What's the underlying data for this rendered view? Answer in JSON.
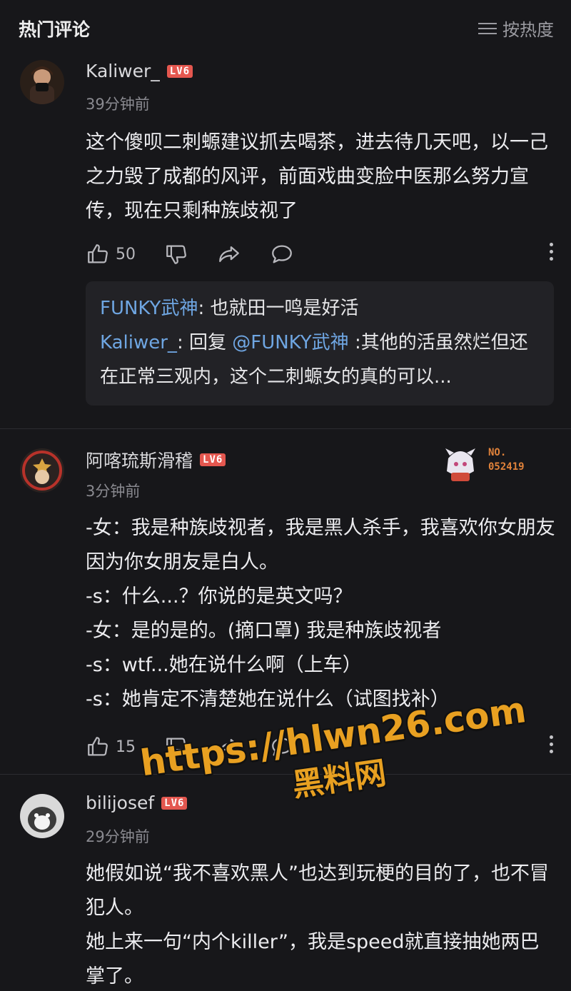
{
  "header": {
    "title": "热门评论",
    "sort_label": "按热度"
  },
  "comments": [
    {
      "username": "Kaliwer_",
      "level": "LV6",
      "time": "39分钟前",
      "text": "这个傻呗二刺螈建议抓去喝茶，进去待几天吧，以一己之力毁了成都的风评，前面戏曲变脸中医那么努力宣传，现在只剩种族歧视了",
      "likes": "50",
      "replies": [
        {
          "name": "FUNKY武神",
          "sep": ": ",
          "text": "也就田一鸣是好活"
        },
        {
          "name": "Kaliwer_",
          "sep": ": 回复 ",
          "mention": "@FUNKY武神",
          "text": " :其他的活虽然烂但还在正常三观内，这个二刺螈女的真的可以..."
        }
      ]
    },
    {
      "username": "阿喀琉斯滑稽",
      "level": "LV6",
      "time": "3分钟前",
      "fan_label": "NO.",
      "fan_number": "052419",
      "text": "-女：我是种族歧视者，我是黑人杀手，我喜欢你女朋友因为你女朋友是白人。\n-s：什么...？你说的是英文吗？\n-女：是的是的。(摘口罩) 我是种族歧视者\n-s：wtf...她在说什么啊（上车）\n-s：她肯定不清楚她在说什么（试图找补）",
      "likes": "15"
    },
    {
      "username": "bilijosef",
      "level": "LV6",
      "time": "29分钟前",
      "text": "她假如说“我不喜欢黑人”也达到玩梗的目的了，也不冒犯人。\n她上来一句“内个killer”，我是speed就直接抽她两巴掌了。"
    }
  ],
  "watermark": {
    "url": "https://hlwn26.com",
    "name": "黑料网"
  },
  "colors": {
    "background": "#17171a",
    "link": "#6fa6e2",
    "level_badge": "#e4574f",
    "watermark": "#e8a021"
  }
}
